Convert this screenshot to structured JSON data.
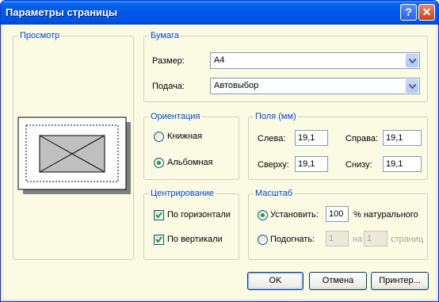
{
  "window": {
    "title": "Параметры страницы",
    "help_glyph": "?",
    "close_glyph": "✕"
  },
  "preview": {
    "legend": "Просмотр"
  },
  "paper": {
    "legend": "Бумага",
    "size_label": "Размер:",
    "size_value": "A4",
    "source_label": "Подача:",
    "source_value": "Автовыбор"
  },
  "orientation": {
    "legend": "Ориентация",
    "portrait": "Книжная",
    "landscape": "Альбомная",
    "selected": "landscape"
  },
  "margins": {
    "legend": "Поля (мм)",
    "left_label": "Слева:",
    "left": "19,1",
    "right_label": "Справа:",
    "right": "19,1",
    "top_label": "Сверху:",
    "top": "19,1",
    "bottom_label": "Снизу:",
    "bottom": "19,1"
  },
  "centering": {
    "legend": "Центрирование",
    "horizontal": "По горизонтали",
    "horizontal_checked": true,
    "vertical": "По вертикали",
    "vertical_checked": true
  },
  "scale": {
    "legend": "Масштаб",
    "adjust_label": "Установить:",
    "adjust_value": "100",
    "adjust_suffix": "% натурального",
    "fit_label": "Подогнать:",
    "fit_wide": "1",
    "fit_on": "на",
    "fit_tall": "1",
    "fit_suffix": "страниц",
    "selected": "adjust"
  },
  "buttons": {
    "ok": "OK",
    "cancel": "Отмена",
    "printer": "Принтер..."
  },
  "colors": {
    "title_bar": "#0054e3",
    "group_legend": "#0046d5",
    "dialog_bg": "#fbfbe4"
  }
}
